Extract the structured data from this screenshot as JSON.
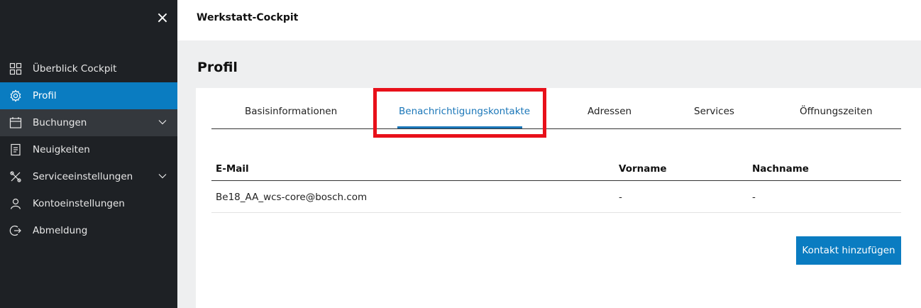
{
  "app": {
    "title": "Werkstatt-Cockpit"
  },
  "sidebar": {
    "close_icon": "×",
    "items": [
      {
        "label": "Überblick Cockpit",
        "icon": "grid-icon"
      },
      {
        "label": "Profil",
        "icon": "gear-icon",
        "active": true
      },
      {
        "label": "Buchungen",
        "icon": "calendar-icon",
        "expandable": true
      },
      {
        "label": "Neuigkeiten",
        "icon": "document-icon"
      },
      {
        "label": "Serviceeinstellungen",
        "icon": "wrench-icon",
        "expandable": true
      },
      {
        "label": "Kontoeinstellungen",
        "icon": "user-icon"
      },
      {
        "label": "Abmeldung",
        "icon": "logout-icon"
      }
    ]
  },
  "page": {
    "title": "Profil"
  },
  "tabs": [
    {
      "label": "Basisinformationen"
    },
    {
      "label": "Benachrichtigungskontakte",
      "active": true
    },
    {
      "label": "Adressen"
    },
    {
      "label": "Services"
    },
    {
      "label": "Öffnungszeiten"
    }
  ],
  "table": {
    "headers": {
      "email": "E-Mail",
      "vorname": "Vorname",
      "nachname": "Nachname"
    },
    "rows": [
      {
        "email": "Be18_AA_wcs-core@bosch.com",
        "vorname": "-",
        "nachname": "-"
      }
    ]
  },
  "actions": {
    "add_contact": "Kontakt hinzufügen"
  },
  "colors": {
    "accent": "#0a7cc1",
    "sidebar_bg": "#1e2125",
    "highlight": "#e8101a"
  }
}
